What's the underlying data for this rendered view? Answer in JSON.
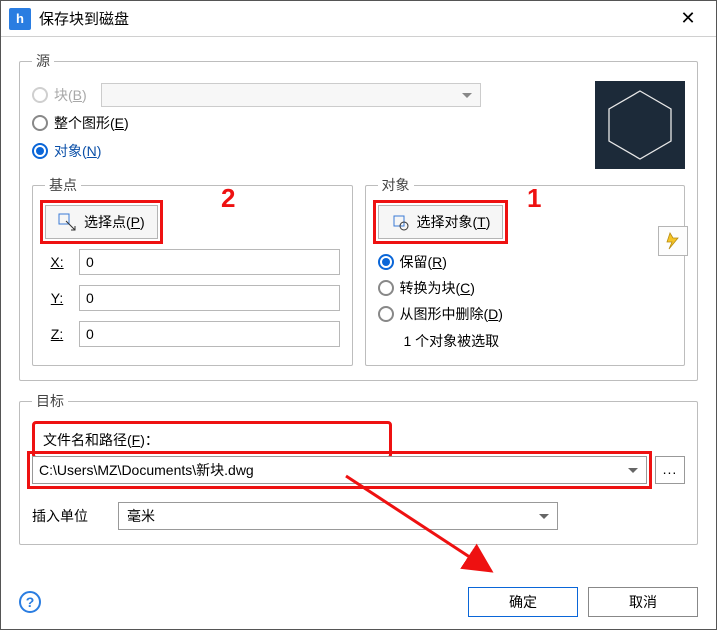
{
  "title": "保存块到磁盘",
  "source": {
    "legend": "源",
    "block_label": "块(B)",
    "entire_label": "整个图形(E)",
    "objects_label": "对象(N)",
    "selected": "objects"
  },
  "basepoint": {
    "legend": "基点",
    "pick_label": "选择点(P)",
    "x_label": "X:",
    "y_label": "Y:",
    "z_label": "Z:",
    "x": "0",
    "y": "0",
    "z": "0"
  },
  "objects": {
    "legend": "对象",
    "select_label": "选择对象(T)",
    "retain_label": "保留(R)",
    "convert_label": "转换为块(C)",
    "delete_label": "从图形中删除(D)",
    "selected": "retain",
    "status": "1 个对象被选取"
  },
  "dest": {
    "legend": "目标",
    "path_label": "文件名和路径(F)：",
    "path_value": "C:\\Users\\MZ\\Documents\\新块.dwg",
    "units_label": "插入单位",
    "units_value": "毫米",
    "browse": "..."
  },
  "footer": {
    "ok": "确定",
    "cancel": "取消",
    "help": "?"
  },
  "annot": {
    "one": "1",
    "two": "2"
  }
}
